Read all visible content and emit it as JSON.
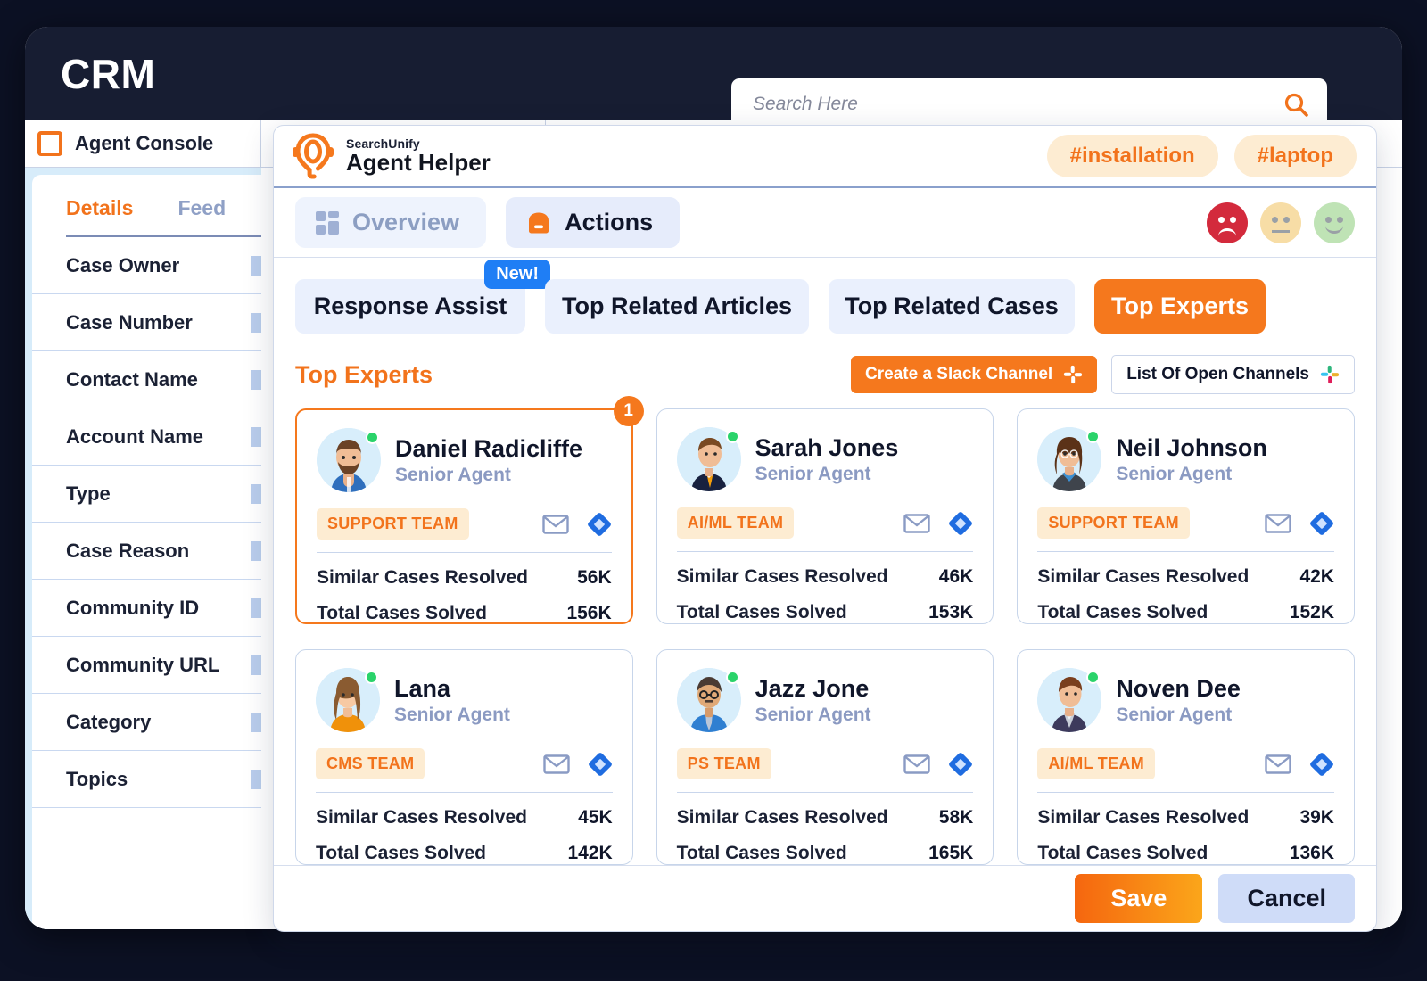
{
  "app": {
    "title": "CRM",
    "search": {
      "placeholder": "Search Here",
      "value": "",
      "icon": "search-icon"
    }
  },
  "console": {
    "tab_label": "Agent Console",
    "tabs": [
      {
        "label": "Details",
        "active": true
      },
      {
        "label": "Feed",
        "active": false
      }
    ],
    "fields": [
      "Case Owner",
      "Case Number",
      "Contact Name",
      "Account Name",
      "Type",
      "Case Reason",
      "Community ID",
      "Community URL",
      "Category",
      "Topics"
    ]
  },
  "helper": {
    "brand_top": "SearchUnify",
    "brand_name": "Agent Helper",
    "brand_icon": "searchunify-logo-icon",
    "tags": [
      "#installation",
      "#laptop"
    ],
    "modes": [
      {
        "label": "Overview",
        "icon": "grid-icon",
        "active": false
      },
      {
        "label": "Actions",
        "icon": "actions-box-icon",
        "active": true
      }
    ],
    "sentiment": [
      {
        "name": "negative",
        "color": "#d32a3c"
      },
      {
        "name": "neutral",
        "color": "#f7dda6"
      },
      {
        "name": "positive",
        "color": "#bfe3b5"
      }
    ],
    "tabs": [
      {
        "label": "Response Assist",
        "active": false,
        "badge": "New!"
      },
      {
        "label": "Top Related Articles",
        "active": false
      },
      {
        "label": "Top Related Cases",
        "active": false
      },
      {
        "label": "Top Experts",
        "active": true
      }
    ],
    "section_title": "Top Experts",
    "actions": {
      "create_slack": "Create a Slack Channel",
      "list_channels": "List Of Open Channels",
      "slack_icon": "slack-icon"
    },
    "stat_labels": {
      "similar": "Similar Cases Resolved",
      "total": "Total Cases Solved"
    },
    "footer": {
      "save": "Save",
      "cancel": "Cancel"
    }
  },
  "experts": [
    {
      "name": "Daniel Radicliffe",
      "role": "Senior Agent",
      "team": "SUPPORT TEAM",
      "similar_cases": "56K",
      "total_cases": "156K",
      "rank": "1",
      "online": true,
      "highlighted": true
    },
    {
      "name": "Sarah Jones",
      "role": "Senior Agent",
      "team": "AI/ML TEAM",
      "similar_cases": "46K",
      "total_cases": "153K",
      "online": true,
      "highlighted": false
    },
    {
      "name": "Neil Johnson",
      "role": "Senior Agent",
      "team": "SUPPORT  TEAM",
      "similar_cases": "42K",
      "total_cases": "152K",
      "online": true,
      "highlighted": false
    },
    {
      "name": "Lana",
      "role": "Senior Agent",
      "team": "CMS TEAM",
      "similar_cases": "45K",
      "total_cases": "142K",
      "online": true,
      "highlighted": false
    },
    {
      "name": "Jazz Jone",
      "role": "Senior Agent",
      "team": "PS TEAM",
      "similar_cases": "58K",
      "total_cases": "165K",
      "online": true,
      "highlighted": false
    },
    {
      "name": "Noven Dee",
      "role": "Senior Agent",
      "team": "AI/ML TEAM",
      "similar_cases": "39K",
      "total_cases": "136K",
      "online": true,
      "highlighted": false
    }
  ],
  "colors": {
    "brand_orange": "#f2731c",
    "accent_orange": "#f5781d",
    "dark_navy": "#171d32",
    "tab_blue": "#eaf0fd",
    "badge_blue": "#1f7ef5"
  }
}
